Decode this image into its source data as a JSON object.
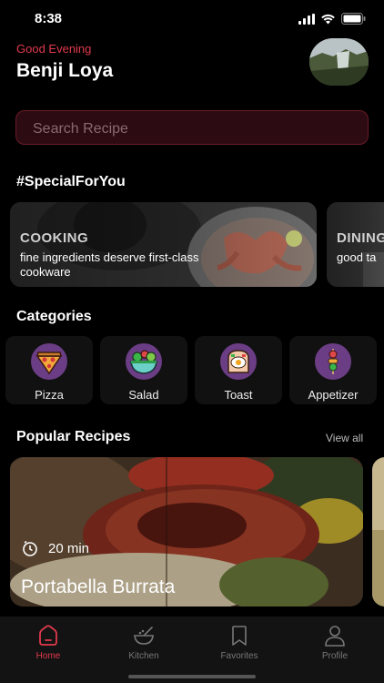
{
  "status": {
    "time": "8:38"
  },
  "header": {
    "greeting": "Good Evening",
    "username": "Benji Loya"
  },
  "search": {
    "placeholder": "Search Recipe"
  },
  "special": {
    "title": "#SpecialForYou",
    "cards": [
      {
        "tag": "COOKING",
        "desc": "fine ingredients deserve first-class cookware"
      },
      {
        "tag": "DINING",
        "desc": "good ta"
      }
    ]
  },
  "categories": {
    "title": "Categories",
    "items": [
      {
        "label": "Pizza",
        "icon": "pizza-icon"
      },
      {
        "label": "Salad",
        "icon": "salad-icon"
      },
      {
        "label": "Toast",
        "icon": "toast-icon"
      },
      {
        "label": "Appetizer",
        "icon": "skewer-icon"
      }
    ]
  },
  "popular": {
    "title": "Popular Recipes",
    "view_all": "View all",
    "recipes": [
      {
        "time": "20 min",
        "title": "Portabella Burrata"
      }
    ]
  },
  "tabs": [
    {
      "label": "Home",
      "icon": "home-icon",
      "active": true
    },
    {
      "label": "Kitchen",
      "icon": "kitchen-icon",
      "active": false
    },
    {
      "label": "Favorites",
      "icon": "bookmark-icon",
      "active": false
    },
    {
      "label": "Profile",
      "icon": "profile-icon",
      "active": false
    }
  ],
  "colors": {
    "accent": "#e0394d",
    "category_icon_bg": "#6b3d85",
    "background": "#000000"
  }
}
